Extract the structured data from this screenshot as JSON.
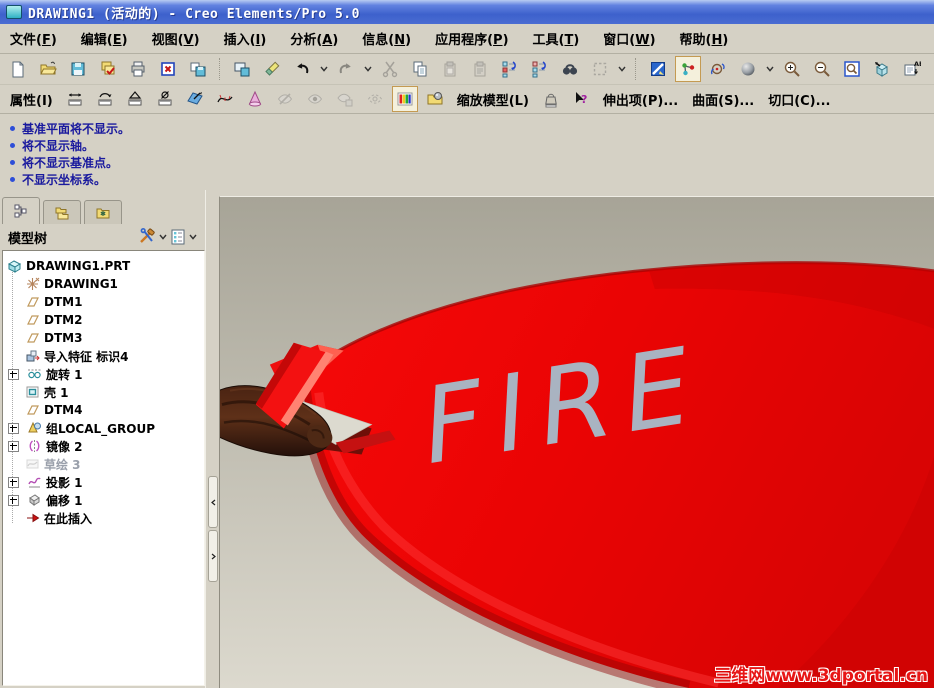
{
  "window": {
    "title": "DRAWING1 (活动的) - Creo Elements/Pro 5.0"
  },
  "menu": {
    "items": [
      {
        "pre": "文件(",
        "key": "F",
        "post": ")"
      },
      {
        "pre": "编辑(",
        "key": "E",
        "post": ")"
      },
      {
        "pre": "视图(",
        "key": "V",
        "post": ")"
      },
      {
        "pre": "插入(",
        "key": "I",
        "post": ")"
      },
      {
        "pre": "分析(",
        "key": "A",
        "post": ")"
      },
      {
        "pre": "信息(",
        "key": "N",
        "post": ")"
      },
      {
        "pre": "应用程序(",
        "key": "P",
        "post": ")"
      },
      {
        "pre": "工具(",
        "key": "T",
        "post": ")"
      },
      {
        "pre": "窗口(",
        "key": "W",
        "post": ")"
      },
      {
        "pre": "帮助(",
        "key": "H",
        "post": ")"
      }
    ]
  },
  "toolbar2": {
    "attributes_label": "属性(I)",
    "zoom_model_label": "缩放模型(L)",
    "protrusion_label": "伸出项(P)...",
    "surface_label": "曲面(S)...",
    "cut_label": "切口(C)..."
  },
  "messages": {
    "lines": [
      "基准平面将不显示。",
      "将不显示轴。",
      "将不显示基准点。",
      "不显示坐标系。"
    ]
  },
  "model_tree": {
    "title": "模型树",
    "items": [
      {
        "label": "DRAWING1.PRT",
        "icon": "part-icon",
        "level": 0,
        "expandable": false,
        "grayed": false
      },
      {
        "label": "DRAWING1",
        "icon": "csys-icon",
        "level": 1,
        "expandable": false,
        "grayed": false
      },
      {
        "label": "DTM1",
        "icon": "datum-plane-icon",
        "level": 1,
        "expandable": false,
        "grayed": false
      },
      {
        "label": "DTM2",
        "icon": "datum-plane-icon",
        "level": 1,
        "expandable": false,
        "grayed": false
      },
      {
        "label": "DTM3",
        "icon": "datum-plane-icon",
        "level": 1,
        "expandable": false,
        "grayed": false
      },
      {
        "label": "导入特征 标识4",
        "icon": "import-feature-icon",
        "level": 1,
        "expandable": false,
        "grayed": false
      },
      {
        "label": "旋转 1",
        "icon": "revolve-icon",
        "level": 1,
        "expandable": true,
        "grayed": false
      },
      {
        "label": "壳 1",
        "icon": "shell-icon",
        "level": 1,
        "expandable": false,
        "grayed": false
      },
      {
        "label": "DTM4",
        "icon": "datum-plane-icon",
        "level": 1,
        "expandable": false,
        "grayed": false
      },
      {
        "label": "组LOCAL_GROUP",
        "icon": "group-icon",
        "level": 1,
        "expandable": true,
        "grayed": false
      },
      {
        "label": "镜像 2",
        "icon": "mirror-icon",
        "level": 1,
        "expandable": true,
        "grayed": false
      },
      {
        "label": "草绘 3",
        "icon": "sketch-icon",
        "level": 1,
        "expandable": false,
        "grayed": true
      },
      {
        "label": "投影 1",
        "icon": "projection-icon",
        "level": 1,
        "expandable": true,
        "grayed": false
      },
      {
        "label": "偏移 1",
        "icon": "offset-icon",
        "level": 1,
        "expandable": true,
        "grayed": false
      },
      {
        "label": "在此插入",
        "icon": "insert-here-icon",
        "level": 1,
        "expandable": false,
        "grayed": false
      }
    ]
  },
  "viewport": {
    "fire_text": "FIRE",
    "watermark": "三维网www.3dportal.cn"
  },
  "colors": {
    "titlebar_blue": "#3d61cc",
    "chrome_beige": "#d5d1c5",
    "message_text": "#1a1a9e",
    "bucket_red": "#ea0404",
    "fire_text_gray": "#a9b3c1",
    "watermark_red": "#e81616",
    "log_brown": "#4a2312"
  },
  "icons": {
    "app": "teal-square",
    "message_bullet": "blue-dot",
    "undo": "curved-arrow-left",
    "redo": "curved-arrow-right",
    "cut": "scissors",
    "find": "binoculars",
    "zoom_in": "magnifier-plus",
    "zoom_out": "magnifier-minus",
    "shaded_view": "gray-sphere",
    "layers": "stacked-sheets",
    "insert_here": "red-arrow"
  }
}
